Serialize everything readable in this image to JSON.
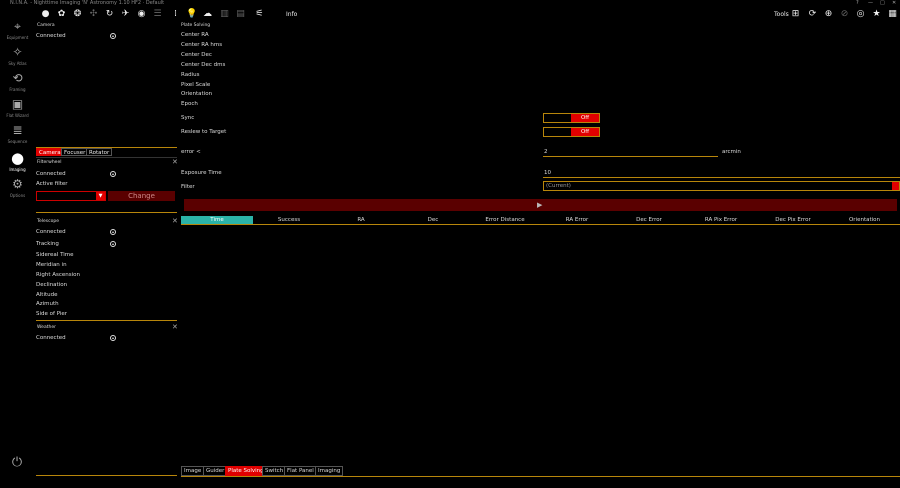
{
  "window": {
    "title": "N.I.N.A. - Nighttime Imaging 'N' Astronomy  1.10 HF2  ·  Default",
    "controls": [
      "?",
      "—",
      "□",
      "✕"
    ]
  },
  "toolbar": {
    "info_label": "Info",
    "tools_label": "Tools"
  },
  "nav": [
    {
      "label": "Equipment",
      "icon": "telescope-icon"
    },
    {
      "label": "Sky Atlas",
      "icon": "atlas-icon"
    },
    {
      "label": "Framing",
      "icon": "framing-icon"
    },
    {
      "label": "Flat Wizard",
      "icon": "flat-wizard-icon"
    },
    {
      "label": "Sequence",
      "icon": "sequence-icon"
    },
    {
      "label": "Imaging",
      "icon": "imaging-icon"
    },
    {
      "label": "Options",
      "icon": "gear-icon"
    }
  ],
  "camera": {
    "title": "Camera",
    "connected_label": "Connected"
  },
  "equipment_tabs": [
    "Camera",
    "Focuser",
    "Rotator"
  ],
  "filterwheel": {
    "title": "Filterwheel",
    "connected_label": "Connected",
    "active_filter_label": "Active filter",
    "change_label": "Change"
  },
  "telescope": {
    "title": "Telescope",
    "rows": [
      "Connected",
      "Tracking",
      "Sidereal Time",
      "Meridian in",
      "Right Ascension",
      "Declination",
      "Altitude",
      "Azimuth",
      "Side of Pier"
    ]
  },
  "weather": {
    "title": "Weather",
    "connected_label": "Connected"
  },
  "platesolve": {
    "title": "Plate Solving",
    "labels": [
      "Center RA",
      "Center RA hms",
      "Center Dec",
      "Center Dec dms",
      "Radius",
      "Pixel Scale",
      "Orientation",
      "Epoch"
    ],
    "sync_label": "Sync",
    "reslew_label": "Reslew to Target",
    "sync_value": "Off",
    "reslew_value": "Off",
    "error_label": "error <",
    "error_value": "2",
    "error_unit": "arcmin",
    "exposure_label": "Exposure Time",
    "exposure_value": "10",
    "filter_label": "Filter",
    "filter_value": "(Current)",
    "columns": [
      "Time",
      "Success",
      "RA",
      "Dec",
      "Error Distance",
      "RA Error",
      "Dec Error",
      "RA Pix Error",
      "Dec Pix Error",
      "Orientation"
    ]
  },
  "bottom_tabs": [
    "Image",
    "Guider",
    "Plate Solving",
    "Switch",
    "Flat Panel",
    "Imaging"
  ],
  "colors": {
    "accent": "#e00000",
    "gold": "#b8860b",
    "teal": "#2bb3a8"
  }
}
